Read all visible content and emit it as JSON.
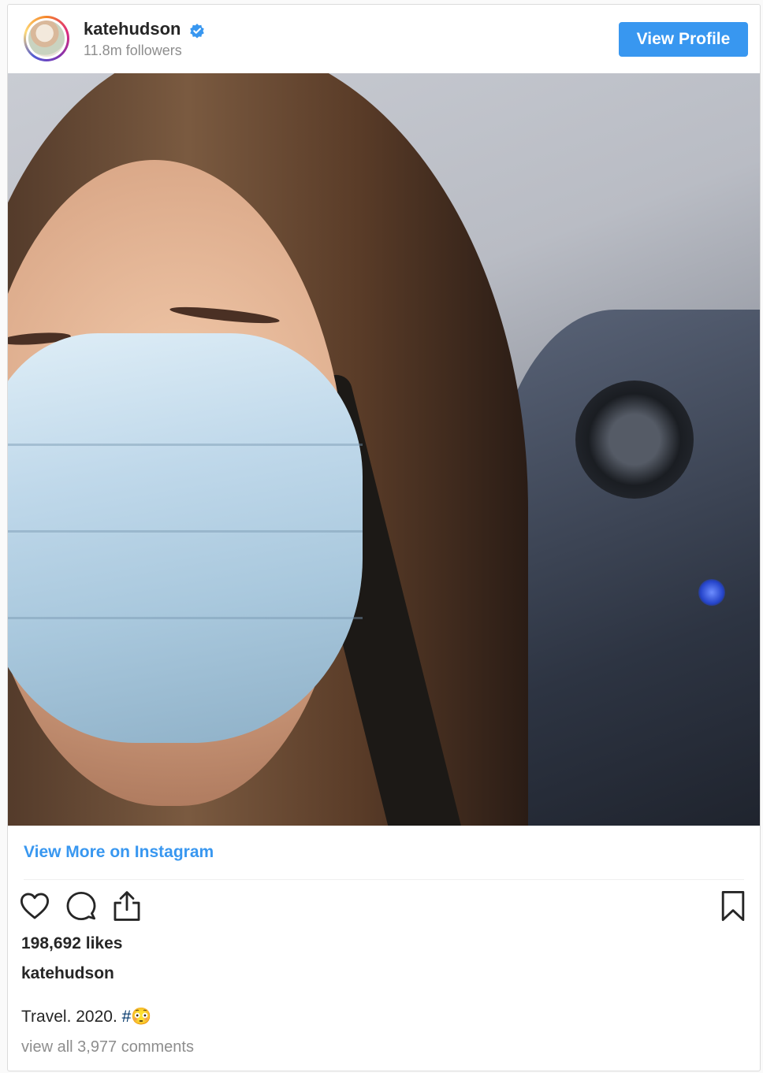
{
  "header": {
    "username": "katehudson",
    "verified_icon": "verified-badge-icon",
    "followers": "11.8m followers",
    "view_profile_label": "View Profile"
  },
  "post": {
    "photo_alt": "Selfie of person wearing a blue surgical face mask inside an airplane cabin",
    "view_more_label": "View More on Instagram",
    "likes": "198,692 likes",
    "caption_user": "katehudson",
    "caption_text": "Travel. 2020. ",
    "caption_hashtag": "#😳",
    "comments_link": "view all 3,977 comments"
  },
  "actions": {
    "icons": [
      "heart-icon",
      "comment-icon",
      "share-icon",
      "bookmark-icon"
    ]
  },
  "colors": {
    "accent": "#3897f0",
    "text": "#262626",
    "muted": "#8e8e8e",
    "hashtag": "#003569"
  }
}
